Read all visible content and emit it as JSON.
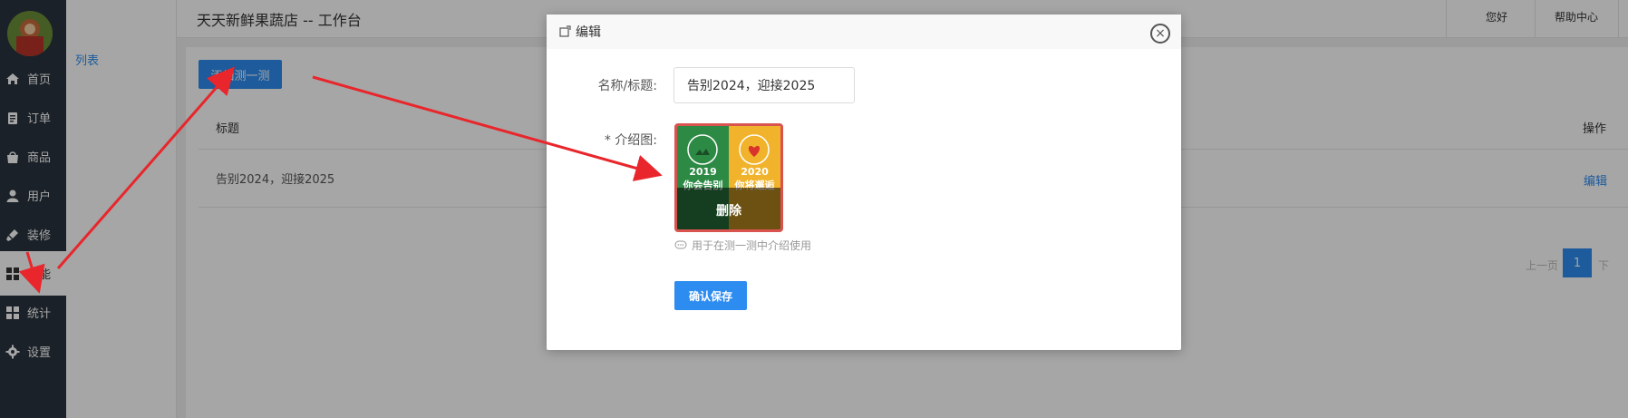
{
  "header": {
    "title": "天天新鲜果蔬店 -- 工作台",
    "greeting": "您好",
    "help": "帮助中心"
  },
  "sidebar": {
    "items": [
      {
        "label": "首页",
        "icon": "home-icon"
      },
      {
        "label": "订单",
        "icon": "clipboard-icon"
      },
      {
        "label": "商品",
        "icon": "shopping-bag-icon"
      },
      {
        "label": "用户",
        "icon": "user-icon"
      },
      {
        "label": "装修",
        "icon": "brush-icon"
      },
      {
        "label": "功能",
        "icon": "grid-icon"
      },
      {
        "label": "统计",
        "icon": "grid-icon"
      },
      {
        "label": "设置",
        "icon": "gear-icon"
      }
    ]
  },
  "subnav": {
    "item": "列表"
  },
  "main": {
    "add_button": "添加测一测",
    "columns": {
      "title": "标题",
      "actions": "操作"
    },
    "rows": [
      {
        "title": "告别2024，迎接2025",
        "action": "编辑"
      }
    ],
    "pagination": {
      "prev": "上一页",
      "current": "1",
      "next": "下"
    }
  },
  "modal": {
    "title": "编辑",
    "fields": {
      "name_label": "名称/标题:",
      "name_value": "告别2024，迎接2025",
      "image_label": "* 介绍图:",
      "image_hint": "用于在测一测中介绍使用",
      "delete_label": "删除",
      "thumb_left_text": "2019\n你会告别",
      "thumb_right_text": "2020\n你将邂逅"
    },
    "save_button": "确认保存"
  },
  "colors": {
    "primary": "#2d8cf0",
    "sidebar_bg": "#28333e",
    "annotation_red": "#e8262b"
  }
}
